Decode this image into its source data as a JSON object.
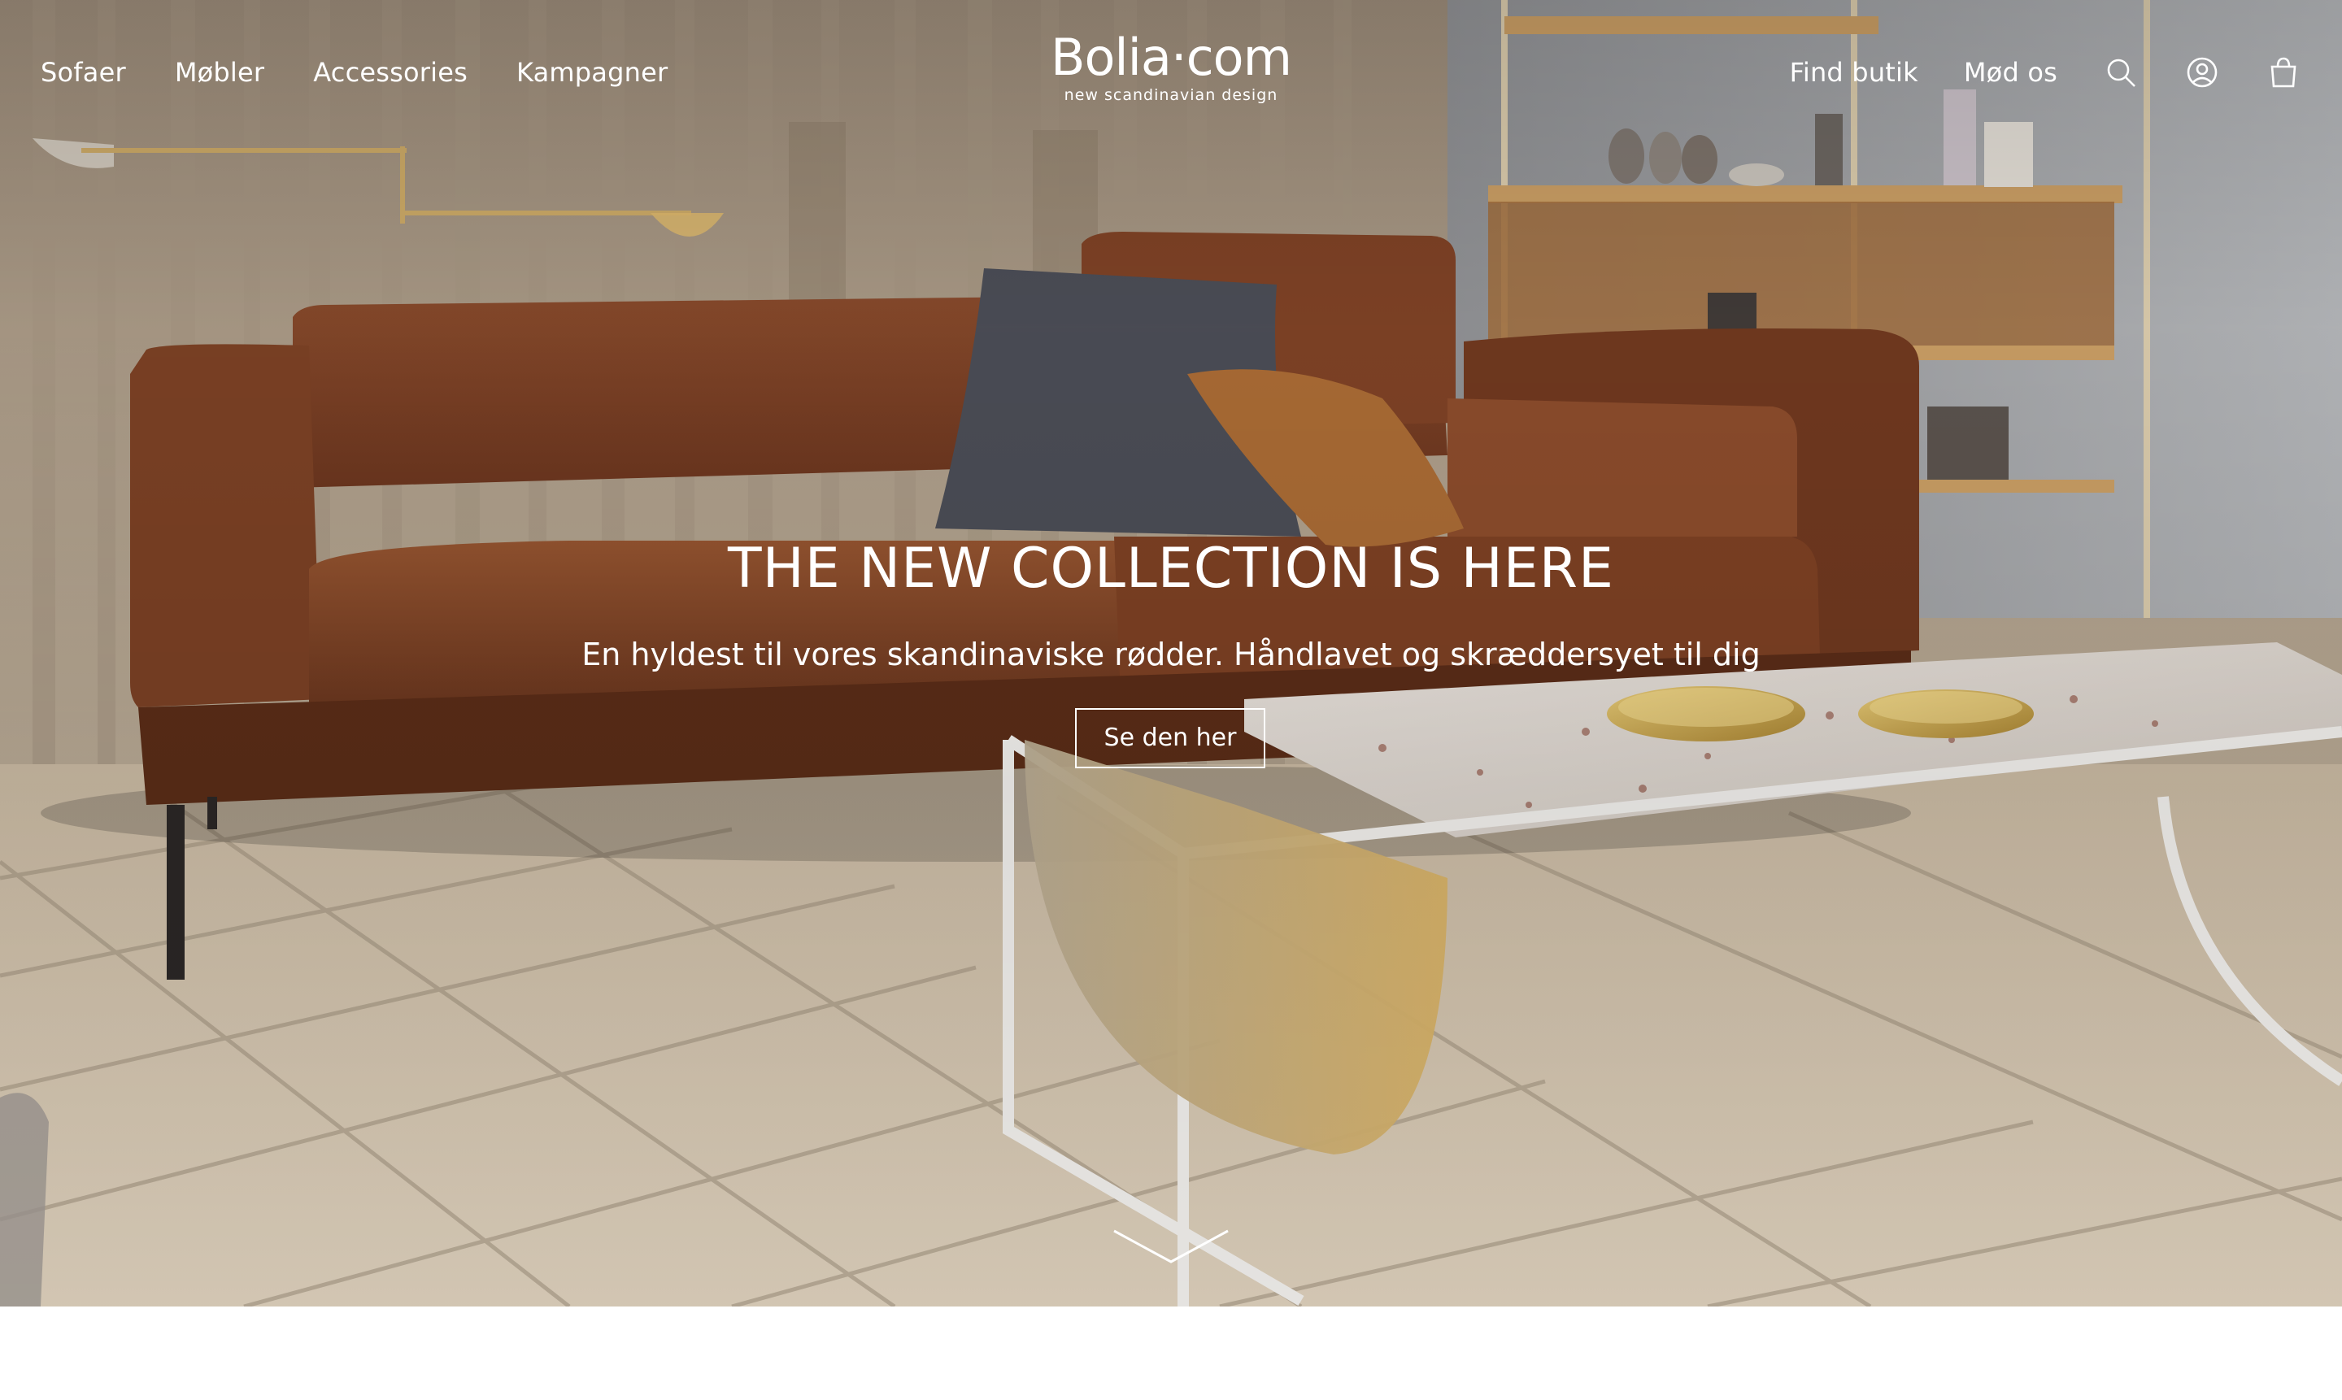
{
  "header": {
    "nav_left": [
      {
        "label": "Sofaer"
      },
      {
        "label": "Møbler"
      },
      {
        "label": "Accessories"
      },
      {
        "label": "Kampagner"
      }
    ],
    "logo": {
      "wordmark": "Bolia·com",
      "tagline": "new scandinavian design"
    },
    "nav_right": [
      {
        "label": "Find butik"
      },
      {
        "label": "Mød os"
      }
    ],
    "icons": [
      "search-icon",
      "user-account-icon",
      "shopping-bag-icon"
    ]
  },
  "hero": {
    "title": "THE NEW COLLECTION IS HERE",
    "subtitle": "En hyldest til vores skandinaviske rødder. Håndlavet og skræddersyet til dig",
    "cta_label": "Se den her",
    "scroll_icon": "chevron-down-icon"
  },
  "colors": {
    "text": "#ffffff",
    "sofa": "#7a3f25",
    "floor": "#d6c8b1",
    "page_background": "#ffffff"
  }
}
